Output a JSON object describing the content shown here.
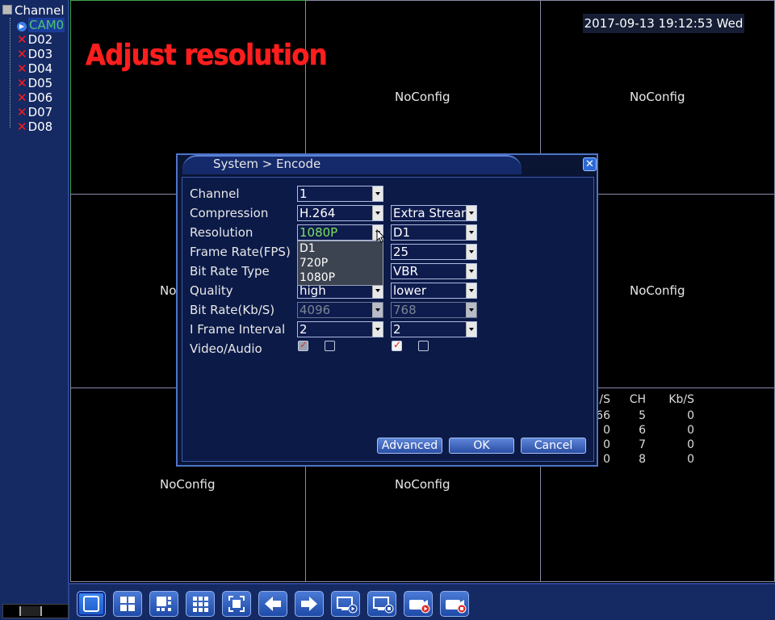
{
  "sidebar": {
    "title": "Channel",
    "channels": [
      {
        "label": "CAM0",
        "status": "playing",
        "selected": true
      },
      {
        "label": "D02",
        "status": "offline"
      },
      {
        "label": "D03",
        "status": "offline"
      },
      {
        "label": "D04",
        "status": "offline"
      },
      {
        "label": "D05",
        "status": "offline"
      },
      {
        "label": "D06",
        "status": "offline"
      },
      {
        "label": "D07",
        "status": "offline"
      },
      {
        "label": "D08",
        "status": "offline"
      }
    ]
  },
  "overlay_title": "Adjust resolution",
  "datetime": "2017-09-13 19:12:53 Wed",
  "cells": {
    "placeholder": "NoConfig",
    "partial_placeholder": "No"
  },
  "stats": {
    "headers": [
      "/S",
      "CH",
      "Kb/S"
    ],
    "rows": [
      [
        "66",
        "5",
        "0"
      ],
      [
        "0",
        "6",
        "0"
      ],
      [
        "0",
        "7",
        "0"
      ],
      [
        "0",
        "8",
        "0"
      ]
    ]
  },
  "dialog": {
    "title": "System > Encode",
    "labels": {
      "channel": "Channel",
      "compression": "Compression",
      "resolution": "Resolution",
      "frame_rate": "Frame Rate(FPS)",
      "bit_rate_type": "Bit Rate Type",
      "quality": "Quality",
      "bit_rate": "Bit Rate(Kb/S)",
      "i_frame": "I Frame Interval",
      "video_audio": "Video/Audio"
    },
    "main": {
      "channel": "1",
      "compression": "H.264",
      "resolution": "1080P",
      "quality": "high",
      "bit_rate": "4096",
      "i_frame": "2",
      "video_checked": true,
      "audio_checked": false
    },
    "extra": {
      "stream": "Extra Stream",
      "resolution": "D1",
      "frame_rate": "25",
      "bit_rate_type": "VBR",
      "quality": "lower",
      "bit_rate": "768",
      "i_frame": "2",
      "video_checked": true,
      "audio_checked": false
    },
    "resolution_options": [
      "D1",
      "720P",
      "1080P"
    ],
    "buttons": {
      "advanced": "Advanced",
      "ok": "OK",
      "cancel": "Cancel"
    }
  },
  "toolbar": {
    "icons": [
      "single-view-icon",
      "quad-view-icon",
      "eight-view-icon",
      "nine-view-icon",
      "fullscreen-icon",
      "previous-icon",
      "next-icon",
      "playback-icon",
      "record-icon",
      "video-record-icon",
      "stop-record-icon"
    ]
  },
  "colors": {
    "panel_bg": "#152a63",
    "grid_line": "#888aa5",
    "active_cell": "#3ea64a",
    "title_red": "#ff1e1e",
    "resolution_green": "#7ce05e"
  }
}
